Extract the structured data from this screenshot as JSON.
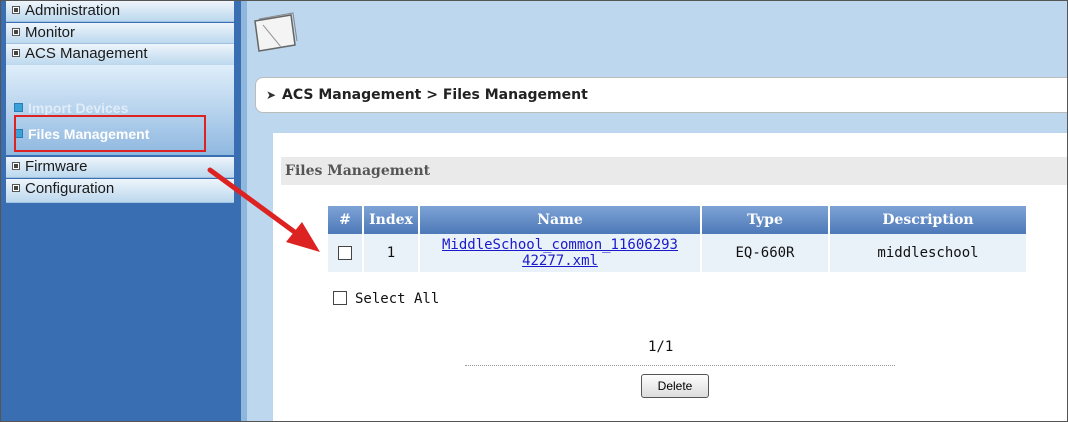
{
  "sidebar": {
    "items": [
      {
        "label": "Administration"
      },
      {
        "label": "Monitor"
      },
      {
        "label": "ACS  Management"
      },
      {
        "label": "Import Devices"
      },
      {
        "label": "Files Management"
      },
      {
        "label": "Firmware"
      },
      {
        "label": "Configuration"
      }
    ]
  },
  "breadcrumb": {
    "text": "ACS Management > Files Management"
  },
  "section": {
    "title": "Files Management"
  },
  "table": {
    "headers": [
      "#",
      "Index",
      "Name",
      "Type",
      "Description"
    ],
    "rows": [
      {
        "index": "1",
        "name_line1": "MiddleSchool_common_11606293",
        "name_line2": "42277.xml",
        "type": "EQ-660R",
        "description": "middleschool"
      }
    ]
  },
  "select_all_label": "Select All",
  "pagination": "1/1",
  "delete_label": "Delete",
  "colors": {
    "sidebar_bg": "#3a6eb2",
    "highlight": "#dd2222",
    "table_header": "#5a85c2"
  }
}
